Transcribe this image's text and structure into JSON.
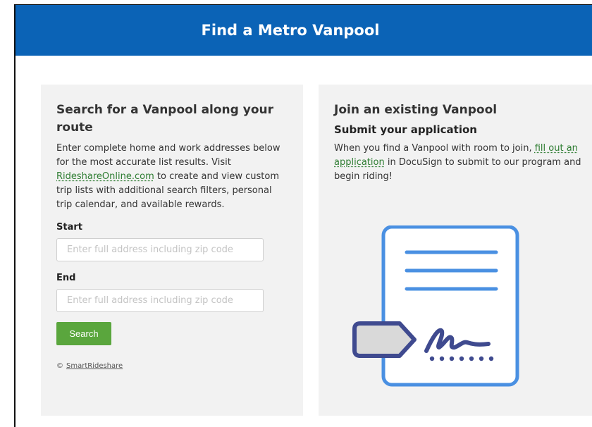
{
  "header": {
    "title": "Find a Metro Vanpool"
  },
  "search_card": {
    "title": "Search for a Vanpool along your route",
    "description_before": "Enter complete home and work addresses below for the most accurate list results. Visit ",
    "link_text": "RideshareOnline.com",
    "description_after": " to create and view custom trip lists with additional search filters, personal trip calendar, and available rewards.",
    "start_label": "Start",
    "start_placeholder": "Enter full address including zip code",
    "end_label": "End",
    "end_placeholder": "Enter full address including zip code",
    "search_button": "Search",
    "credit_symbol": "©",
    "credit_name": "SmartRideshare"
  },
  "join_card": {
    "title": "Join an existing Vanpool",
    "subtitle": "Submit your application",
    "text_before": "When you find a Vanpool with room to join, ",
    "link_text": "fill out an application",
    "text_after": " in DocuSign to submit to our program and begin riding!",
    "illustration": "document-signature-icon"
  },
  "colors": {
    "header_bg": "#0b63b6",
    "card_bg": "#f2f2f2",
    "button_green": "#5aa63d",
    "link_green": "#2e7d32",
    "illustration_blue": "#4a90e2"
  }
}
